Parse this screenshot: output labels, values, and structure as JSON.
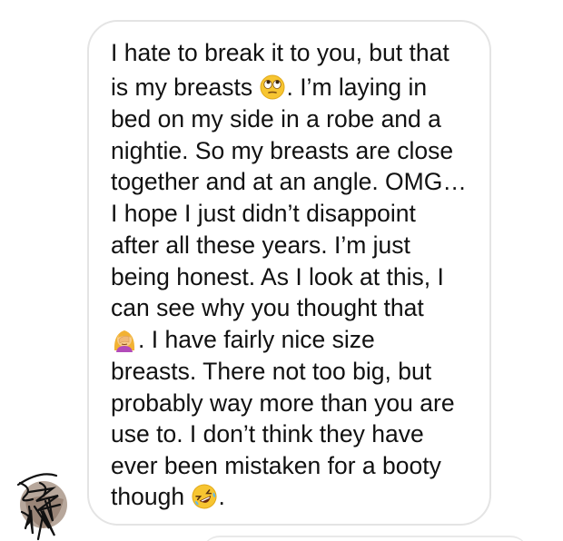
{
  "message": {
    "lines": [
      "I hate to break it to you, but that",
      "is my breasts",
      ".  I’m laying in",
      "bed on my side in a robe and a",
      "nightie.  So my breasts are close",
      "together and at an angle.  OMG…",
      "I hope I just didn’t disappoint",
      "after all these years.  I’m just",
      "being honest. As I look at this, I",
      "can see why you thought that",
      ".   I have fairly nice size",
      "breasts.  There not too big, but",
      "probably way more than you are",
      "use to.   I don’t think they have",
      "ever been mistaken for a booty",
      "though",
      "."
    ],
    "emojis": {
      "eye_roll": "eye-roll-face-icon",
      "facepalm": "woman-facepalming-icon",
      "laughing": "rolling-on-floor-laughing-icon"
    }
  },
  "colors": {
    "bubble_border": "#e4e4e4",
    "text": "#111111",
    "background": "#ffffff"
  }
}
